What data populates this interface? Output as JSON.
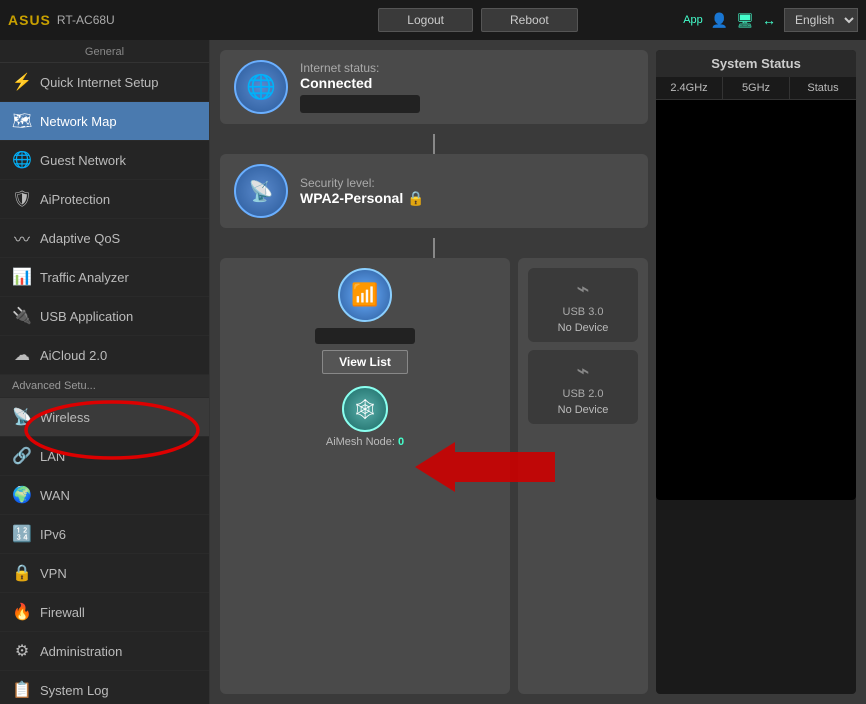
{
  "header": {
    "logo": "ASUS",
    "model": "RT-AC68U",
    "buttons": {
      "logout": "Logout",
      "reboot": "Reboot"
    },
    "app_label": "App",
    "language": "English"
  },
  "sidebar": {
    "section_general": "General",
    "section_advanced": "Advanced Setu...",
    "items": [
      {
        "id": "quick-internet-setup",
        "label": "Quick Internet Setup",
        "icon": "⚡",
        "active": false
      },
      {
        "id": "network-map",
        "label": "Network Map",
        "icon": "🗺",
        "active": true
      },
      {
        "id": "guest-network",
        "label": "Guest Network",
        "icon": "🌐",
        "active": false
      },
      {
        "id": "aiprotection",
        "label": "AiProtection",
        "icon": "🛡",
        "active": false
      },
      {
        "id": "adaptive-qos",
        "label": "Adaptive QoS",
        "icon": "📶",
        "active": false
      },
      {
        "id": "traffic-analyzer",
        "label": "Traffic Analyzer",
        "icon": "📊",
        "active": false
      },
      {
        "id": "usb-application",
        "label": "USB Application",
        "icon": "🔌",
        "active": false
      },
      {
        "id": "aicloud",
        "label": "AiCloud 2.0",
        "icon": "☁",
        "active": false
      },
      {
        "id": "wireless",
        "label": "Wireless",
        "icon": "📡",
        "active": false,
        "highlighted": true
      },
      {
        "id": "lan",
        "label": "LAN",
        "icon": "🔗",
        "active": false
      },
      {
        "id": "wan",
        "label": "WAN",
        "icon": "🌍",
        "active": false
      },
      {
        "id": "ipv6",
        "label": "IPv6",
        "icon": "🔢",
        "active": false
      },
      {
        "id": "vpn",
        "label": "VPN",
        "icon": "🔒",
        "active": false
      },
      {
        "id": "firewall",
        "label": "Firewall",
        "icon": "🔥",
        "active": false
      },
      {
        "id": "administration",
        "label": "Administration",
        "icon": "⚙",
        "active": false
      },
      {
        "id": "system-log",
        "label": "System Log",
        "icon": "📋",
        "active": false
      }
    ]
  },
  "internet_block": {
    "label": "Internet status:",
    "status": "Connected"
  },
  "router_block": {
    "security_label": "Security level:",
    "security_value": "WPA2-Personal 🔒"
  },
  "bottom": {
    "view_list": "View List",
    "aimesh_label": "AiMesh Node:",
    "aimesh_count": "0",
    "usb30_label": "USB 3.0",
    "usb30_status": "No Device",
    "usb20_label": "USB 2.0",
    "usb20_status": "No Device"
  },
  "system_status": {
    "title": "System Status",
    "col1": "2.4GHz",
    "col2": "5GHz",
    "col3": "Status"
  }
}
